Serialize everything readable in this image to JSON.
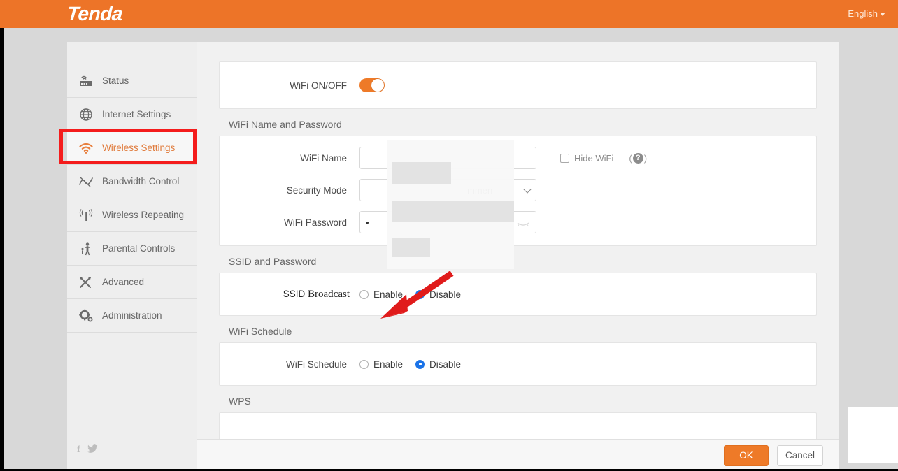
{
  "header": {
    "logo": "Tenda",
    "language": "English",
    "brand_orange": "#ed7428"
  },
  "sidebar": {
    "items": [
      {
        "label": "Status",
        "icon": "router-icon",
        "active": false
      },
      {
        "label": "Internet Settings",
        "icon": "globe-icon",
        "active": false
      },
      {
        "label": "Wireless Settings",
        "icon": "wifi-icon",
        "active": true
      },
      {
        "label": "Bandwidth Control",
        "icon": "chart-line-icon",
        "active": false
      },
      {
        "label": "Wireless Repeating",
        "icon": "antenna-icon",
        "active": false
      },
      {
        "label": "Parental Controls",
        "icon": "parent-child-icon",
        "active": false
      },
      {
        "label": "Advanced",
        "icon": "tools-icon",
        "active": false
      },
      {
        "label": "Administration",
        "icon": "gear-icon",
        "active": false
      }
    ],
    "social": [
      {
        "name": "facebook-icon",
        "glyph": "f"
      },
      {
        "name": "twitter-icon",
        "glyph": "✉"
      }
    ]
  },
  "main": {
    "wifi_onoff": {
      "label": "WiFi ON/OFF",
      "state": "on"
    },
    "wifi_name_password": {
      "section_title": "WiFi Name and Password",
      "wifi_name_label": "WiFi Name",
      "wifi_name_value": "",
      "hide_wifi_label": "Hide WiFi",
      "hide_wifi_checked": false,
      "help_glyph": "?",
      "security_mode_label": "Security Mode",
      "security_mode_value": "mmen",
      "wifi_password_label": "WiFi Password",
      "wifi_password_value": "•"
    },
    "ssid_and_password": {
      "section_title": "SSID and Password",
      "ssid_broadcast_label_part1": "SSID ",
      "ssid_broadcast_label_part2": "Broadcast",
      "enable_label": "Enable",
      "disable_label": "Disable",
      "selected": "Disable"
    },
    "wifi_schedule": {
      "section_title": "WiFi Schedule",
      "row_label": "WiFi Schedule",
      "enable_label": "Enable",
      "disable_label": "Disable",
      "selected": "Disable"
    },
    "wps": {
      "section_title": "WPS"
    }
  },
  "footer": {
    "ok_label": "OK",
    "cancel_label": "Cancel"
  },
  "annotation": {
    "highlight_target": "Wireless Settings",
    "highlight_color": "#f41c1c",
    "arrow_color": "#e01b1b",
    "arrow_points_to": "SSID Broadcast Enable radio"
  }
}
